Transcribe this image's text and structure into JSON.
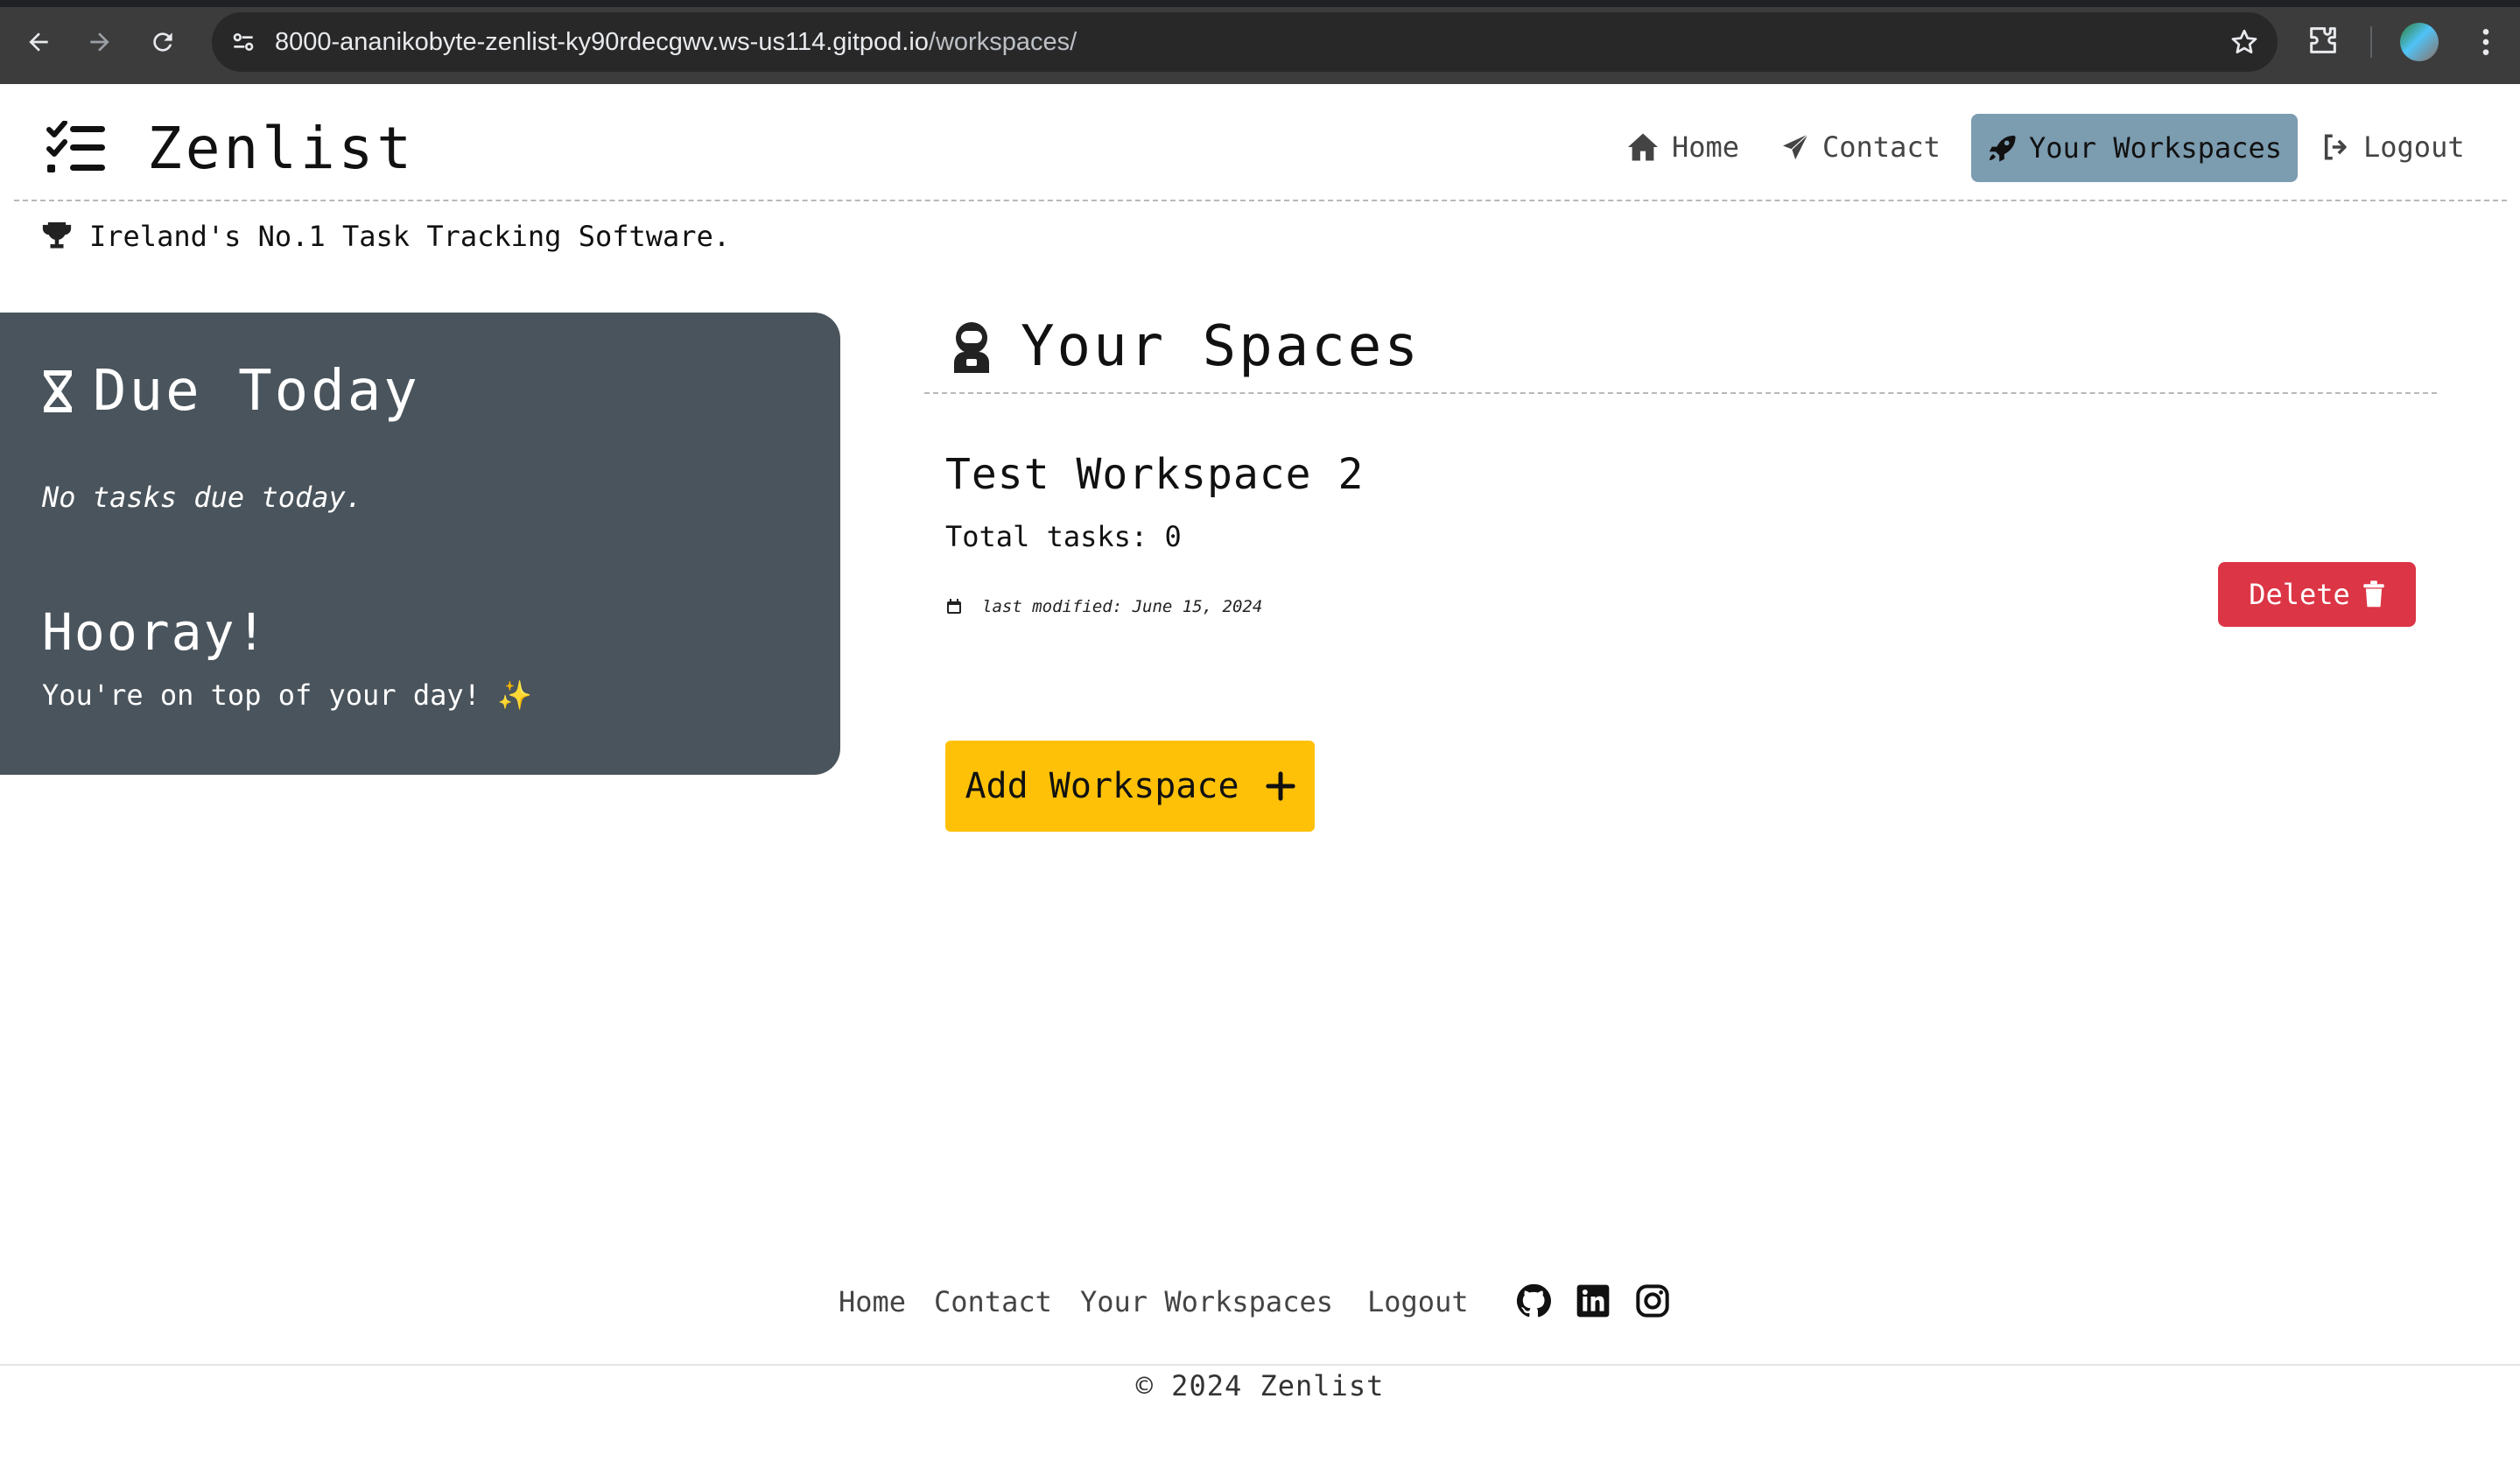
{
  "browser": {
    "url_host": "8000-ananikobyte-zenlist-ky90rdecgwv.ws-us114.gitpod.io",
    "url_path": "/workspaces/",
    "icons": [
      "back-arrow-icon",
      "forward-arrow-icon",
      "reload-icon",
      "site-settings-icon",
      "bookmark-star-icon",
      "extensions-icon",
      "profile-avatar",
      "kebab-menu-icon"
    ]
  },
  "header": {
    "brand": "Zenlist",
    "tagline": "Ireland's No.1 Task Tracking Software.",
    "nav": [
      {
        "label": "Home",
        "icon": "house-icon",
        "active": false
      },
      {
        "label": "Contact",
        "icon": "paper-plane-icon",
        "active": false
      },
      {
        "label": "Your Workspaces",
        "icon": "rocket-icon",
        "active": true
      },
      {
        "label": "Logout",
        "icon": "sign-out-icon",
        "active": false
      }
    ]
  },
  "due_today": {
    "title": "Due Today",
    "empty_text": "No tasks due today.",
    "hooray_title": "Hooray!",
    "hooray_text": "You're on top of your day! ✨"
  },
  "spaces": {
    "title": "Your Spaces",
    "workspaces": [
      {
        "name": "Test Workspace 2",
        "total_tasks": "Total tasks: 0",
        "last_modified": "last modified: June 15, 2024",
        "delete_label": "Delete"
      }
    ],
    "add_label": "Add Workspace"
  },
  "footer": {
    "links": [
      "Home",
      "Contact",
      "Your Workspaces",
      "Logout"
    ],
    "social": [
      "github-icon",
      "linkedin-icon",
      "instagram-icon"
    ],
    "copyright": "© 2024 Zenlist"
  },
  "colors": {
    "active_nav": "#7c9cb0",
    "due_panel": "#4a545c",
    "delete": "#dc3545",
    "add": "#ffc107"
  }
}
